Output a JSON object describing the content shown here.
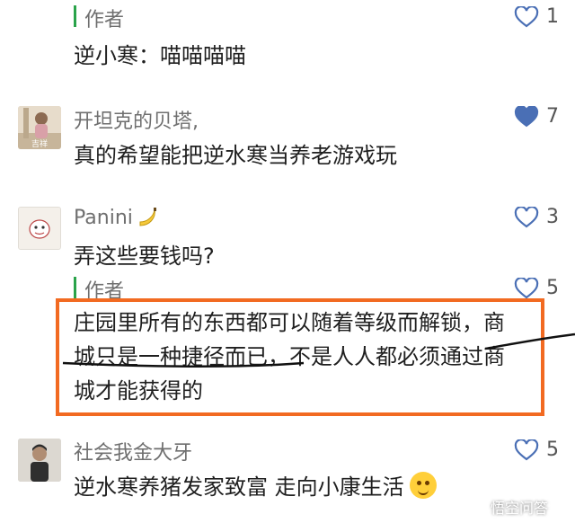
{
  "comments": [
    {
      "id": "c1",
      "is_author": true,
      "name": "作者",
      "text": "逆小寒：喵喵喵喵",
      "likes": "1",
      "liked": false
    },
    {
      "id": "c2",
      "is_author": false,
      "name": "开坦克的贝塔,",
      "text": "真的希望能把逆水寒当养老游戏玩",
      "likes": "7",
      "liked": true,
      "avatar_caption": "吉祥"
    },
    {
      "id": "c3",
      "is_author": false,
      "name": "Panini",
      "name_icon": "banana-icon",
      "text": "弄这些要钱吗?",
      "likes": "3",
      "liked": false
    },
    {
      "id": "c4",
      "is_author": true,
      "name": "作者",
      "lines": [
        "庄园里所有的东西都可以随着等级而解锁，商",
        "城只是一种捷径而已，不是人人都必须通过商",
        "城才能获得的"
      ],
      "likes": "5",
      "liked": false
    },
    {
      "id": "c5",
      "is_author": false,
      "name": "社会我金大牙",
      "text": "逆水寒养猪发家致富 走向小康生活",
      "emoji": "smile-emoji",
      "likes": "5",
      "liked": false
    }
  ],
  "watermark": {
    "text": "悟空问答"
  },
  "colors": {
    "author_bar": "#2aa34a",
    "highlight": "#f26a21",
    "liked_heart": "#4a6fb5"
  }
}
